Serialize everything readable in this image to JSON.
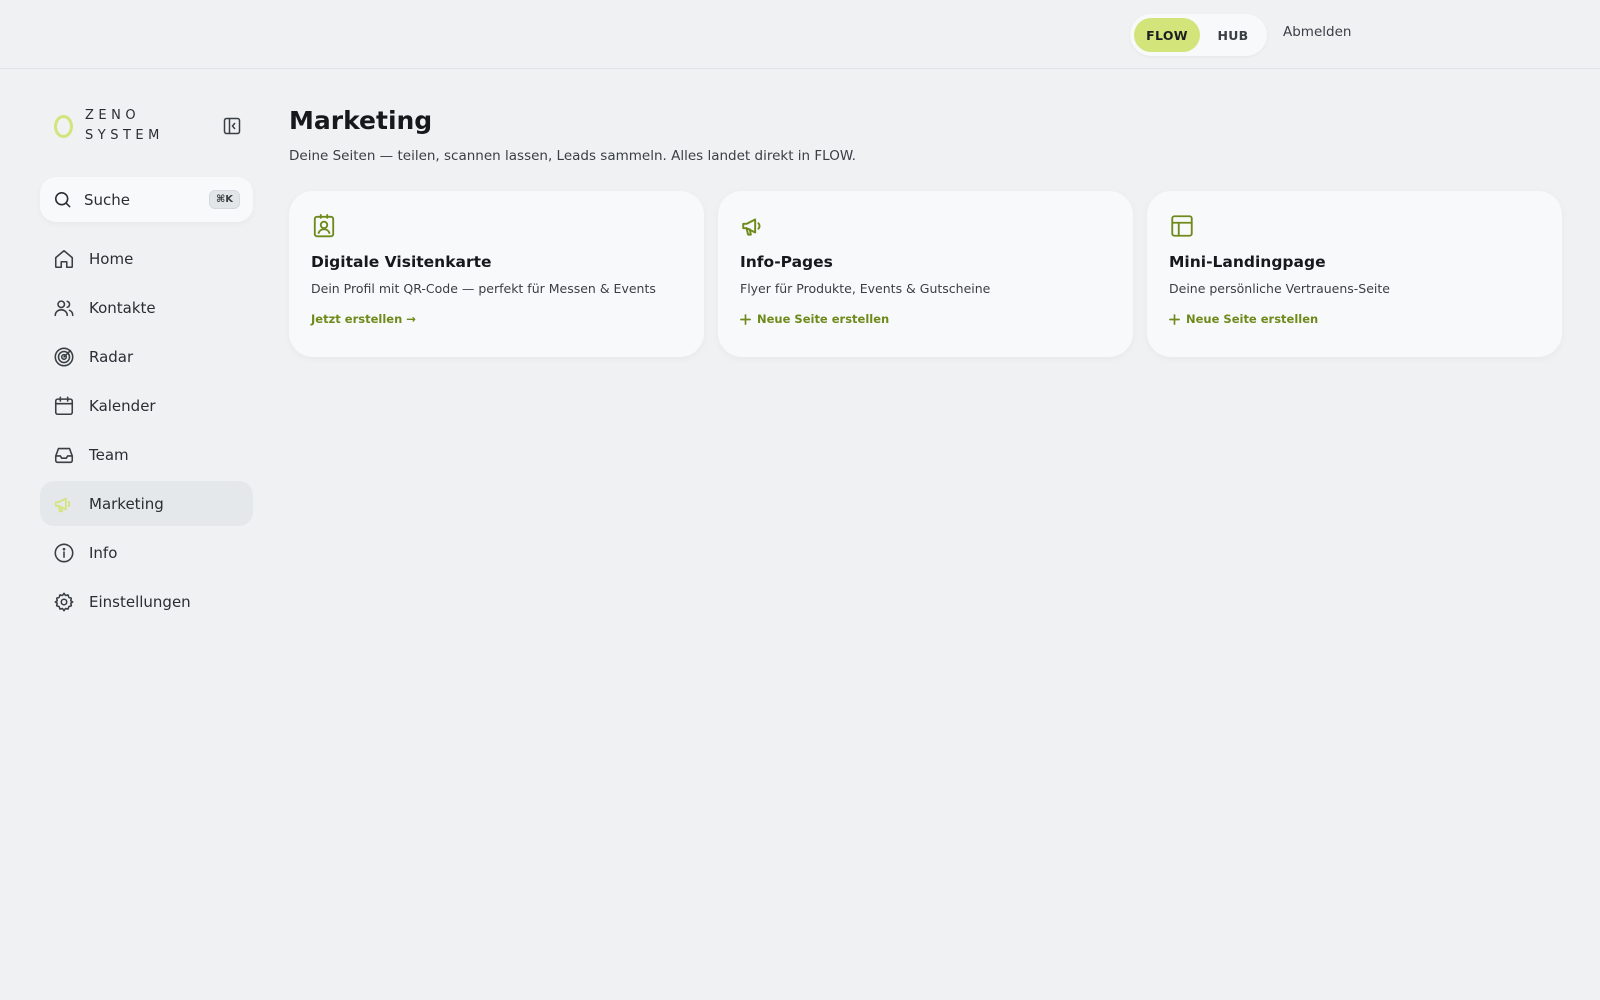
{
  "topbar": {
    "modes": [
      {
        "label": "FLOW",
        "active": true
      },
      {
        "label": "HUB",
        "active": false
      }
    ],
    "logout_label": "Abmelden"
  },
  "brand": {
    "line1": "ZENO",
    "line2": "SYSTEM"
  },
  "search": {
    "label": "Suche",
    "shortcut": "⌘K"
  },
  "nav": [
    {
      "label": "Home",
      "icon": "home-icon"
    },
    {
      "label": "Kontakte",
      "icon": "users-icon"
    },
    {
      "label": "Radar",
      "icon": "radar-icon"
    },
    {
      "label": "Kalender",
      "icon": "calendar-icon"
    },
    {
      "label": "Team",
      "icon": "inbox-icon"
    },
    {
      "label": "Marketing",
      "icon": "megaphone-icon",
      "active": true
    },
    {
      "label": "Info",
      "icon": "info-icon"
    },
    {
      "label": "Einstellungen",
      "icon": "gear-icon"
    }
  ],
  "main": {
    "title": "Marketing",
    "subtitle": "Deine Seiten — teilen, scannen lassen, Leads sammeln. Alles landet direkt in FLOW.",
    "cards": [
      {
        "title": "Digitale Visitenkarte",
        "desc": "Dein Profil mit QR-Code — perfekt für Messen & Events",
        "action": "Jetzt erstellen →",
        "icon": "contact-card-icon"
      },
      {
        "title": "Info-Pages",
        "desc": "Flyer für Produkte, Events & Gutscheine",
        "action": "Neue Seite erstellen",
        "icon": "megaphone-icon"
      },
      {
        "title": "Mini-Landingpage",
        "desc": "Deine persönliche Vertrauens-Seite",
        "action": "Neue Seite erstellen",
        "icon": "layout-icon"
      }
    ]
  },
  "colors": {
    "accent": "#d3e47a",
    "action": "#6e8a1a",
    "icon": "#6e8a1a"
  }
}
